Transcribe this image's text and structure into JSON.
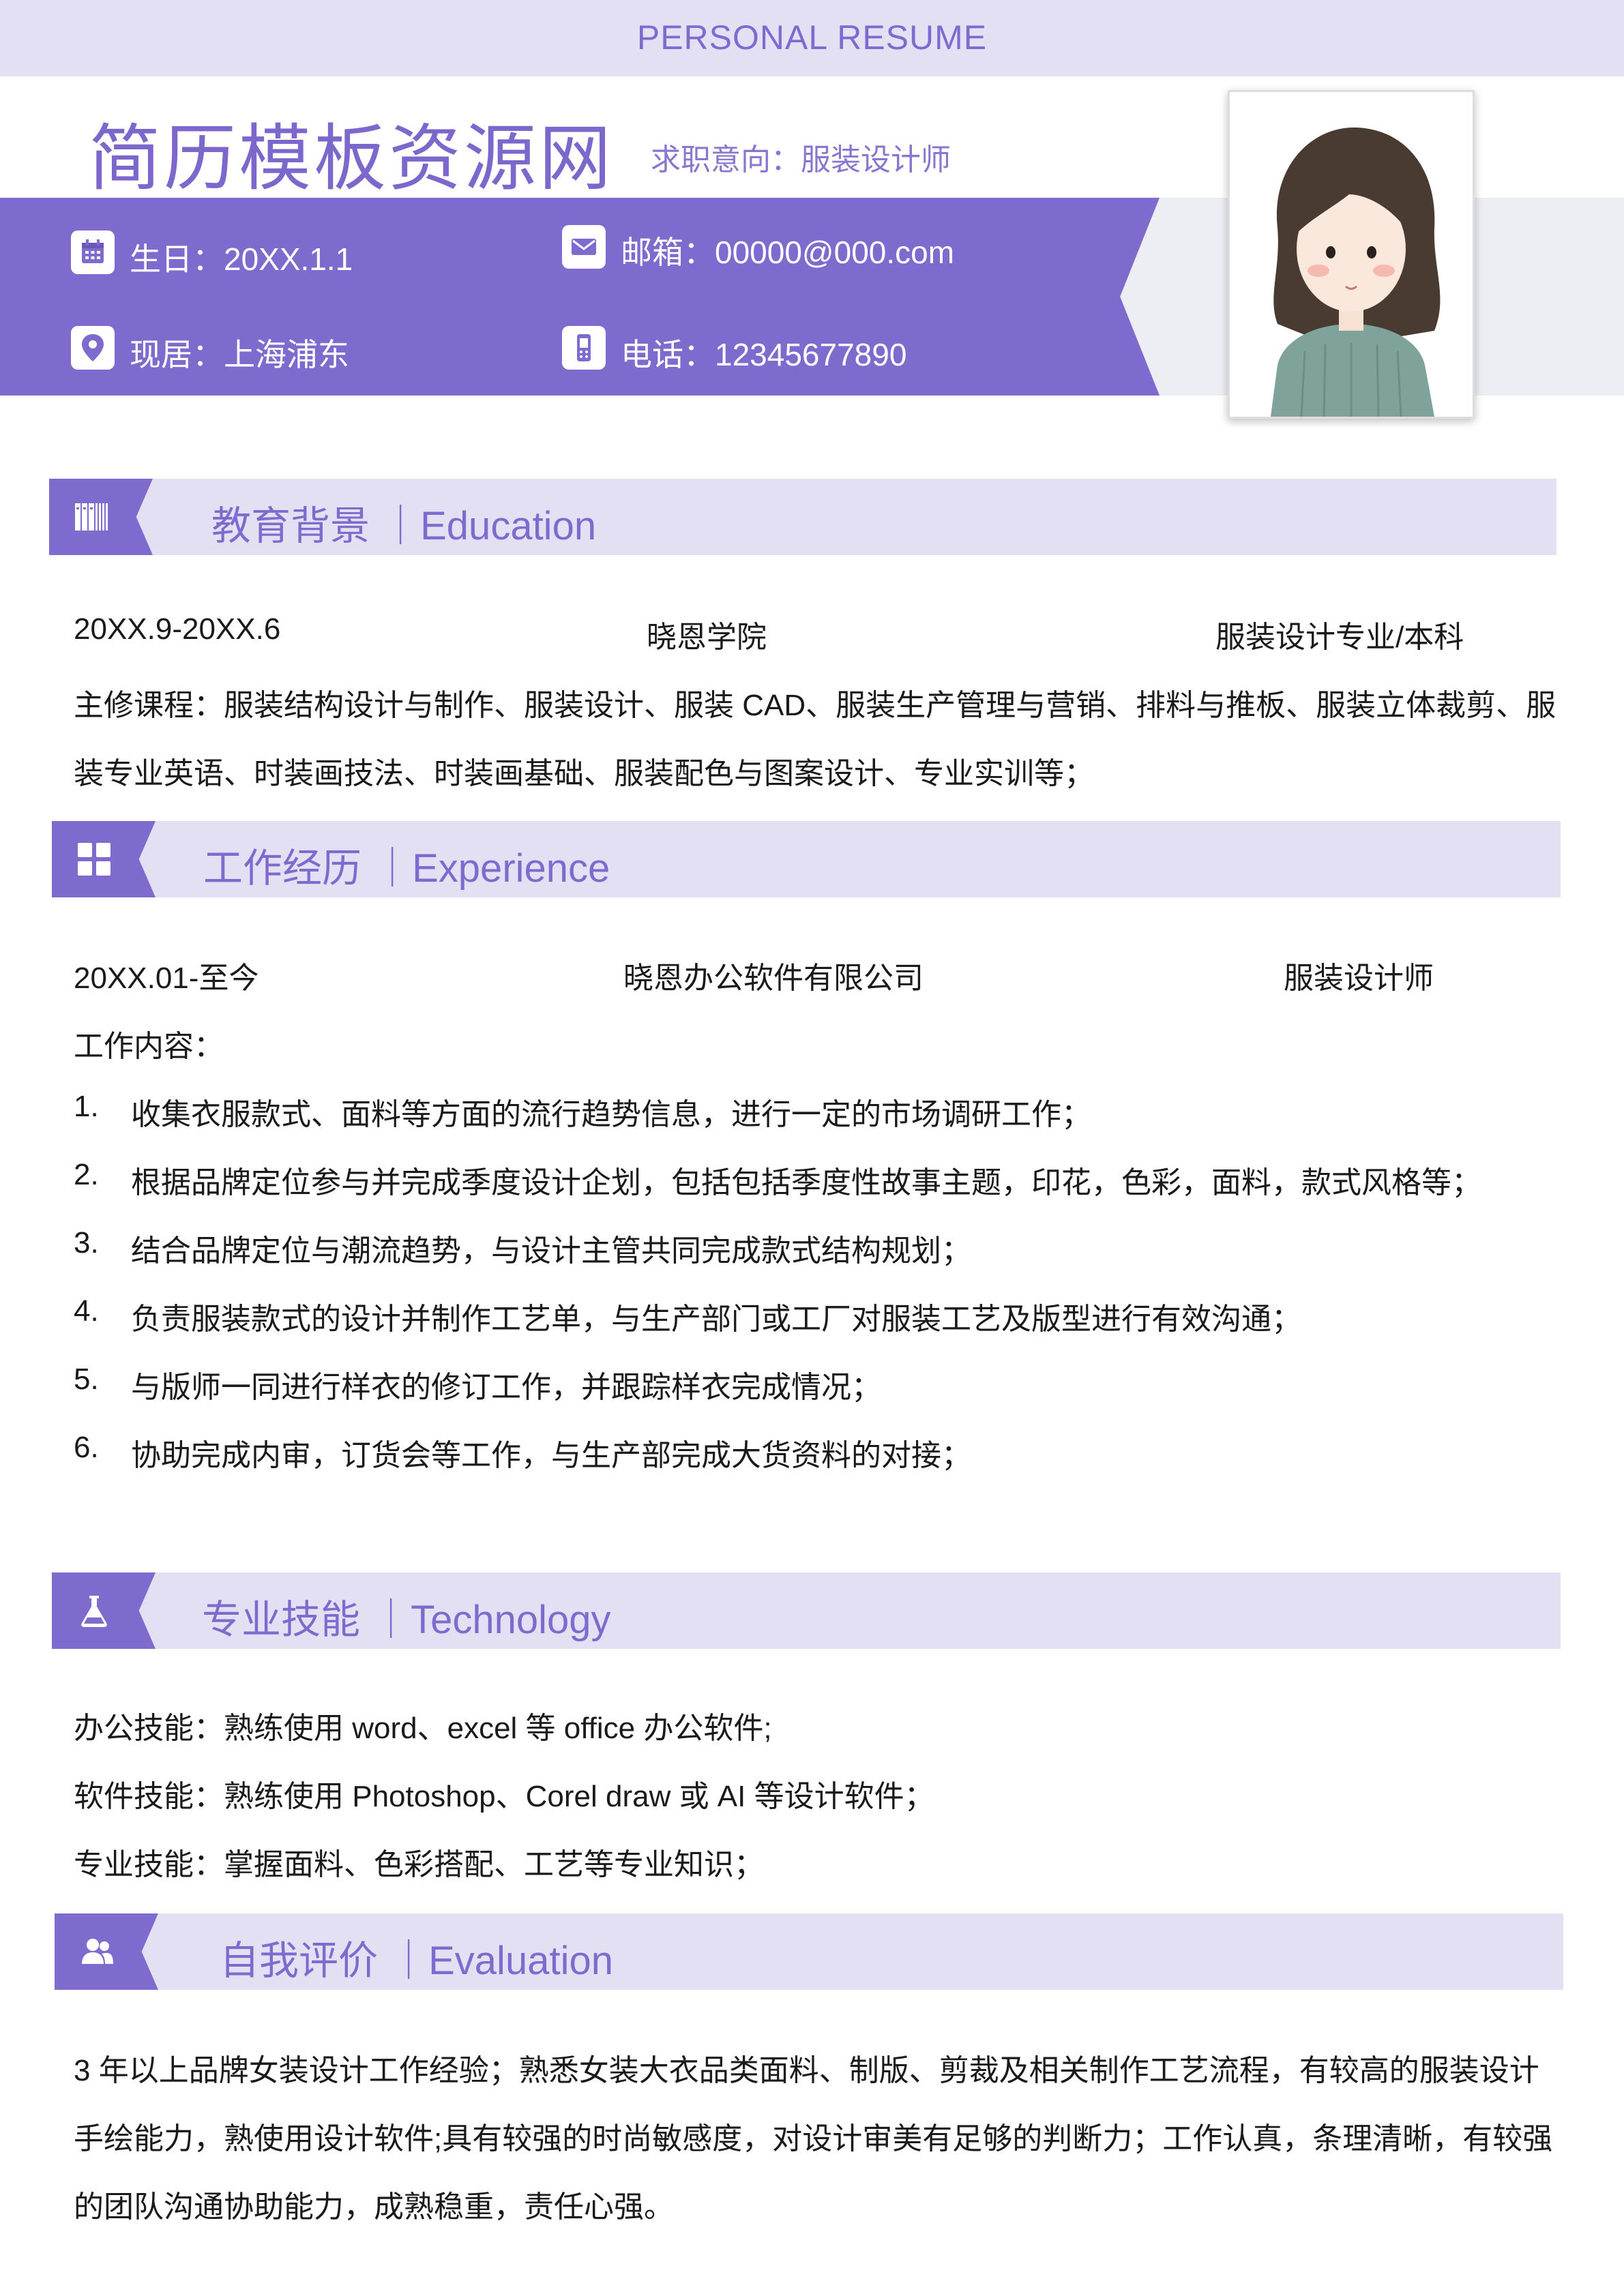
{
  "header": {
    "top_title": "PERSONAL RESUME",
    "name": "简历模板资源网",
    "intent": "求职意向：服装设计师"
  },
  "info": {
    "birthday": "生日：20XX.1.1",
    "email": "邮箱：00000@000.com",
    "location": "现居：上海浦东",
    "phone": "电话：12345677890"
  },
  "sections": {
    "education": {
      "title": "教育背景 ｜Education",
      "period": "20XX.9-20XX.6",
      "school": "晓恩学院",
      "major": "服装设计专业/本科",
      "courses_line1": "主修课程：服装结构设计与制作、服装设计、服装 CAD、服装生产管理与营销、排料与推板、服装立体裁剪、服",
      "courses_line2": "装专业英语、时装画技法、时装画基础、服装配色与图案设计、专业实训等；"
    },
    "experience": {
      "title": "工作经历 ｜Experience",
      "period": "20XX.01-至今",
      "company": "晓恩办公软件有限公司",
      "position": "服装设计师",
      "content_label": "工作内容：",
      "items": [
        {
          "num": "1.",
          "text": "收集衣服款式、面料等方面的流行趋势信息，进行一定的市场调研工作；"
        },
        {
          "num": "2.",
          "text": "根据品牌定位参与并完成季度设计企划，包括包括季度性故事主题，印花，色彩，面料，款式风格等；"
        },
        {
          "num": "3.",
          "text": "结合品牌定位与潮流趋势，与设计主管共同完成款式结构规划；"
        },
        {
          "num": "4.",
          "text": "负责服装款式的设计并制作工艺单，与生产部门或工厂对服装工艺及版型进行有效沟通；"
        },
        {
          "num": "5.",
          "text": "与版师一同进行样衣的修订工作，并跟踪样衣完成情况；"
        },
        {
          "num": "6.",
          "text": "协助完成内审，订货会等工作，与生产部完成大货资料的对接；"
        }
      ]
    },
    "technology": {
      "title": "专业技能 ｜Technology",
      "lines": [
        "办公技能：熟练使用 word、excel 等 office 办公软件;",
        "软件技能：熟练使用 Photoshop、Corel draw 或 AI 等设计软件；",
        "专业技能：掌握面料、色彩搭配、工艺等专业知识；"
      ]
    },
    "evaluation": {
      "title": "自我评价 ｜Evaluation",
      "lines": [
        "3 年以上品牌女装设计工作经验；熟悉女装大衣品类面料、制版、剪裁及相关制作工艺流程，有较高的服装设计",
        "手绘能力，熟使用设计软件;具有较强的时尚敏感度，对设计审美有足够的判断力；工作认真，条理清晰，有较强",
        "的团队沟通协助能力，成熟稳重，责任心强。"
      ]
    }
  },
  "colors": {
    "accent": "#7f6bcd",
    "accent_light": "#e4e0f4",
    "text": "#1a1a1a"
  },
  "icons": [
    "calendar-icon",
    "email-icon",
    "location-icon",
    "phone-icon",
    "books-icon",
    "grid-icon",
    "flask-icon",
    "users-icon"
  ]
}
